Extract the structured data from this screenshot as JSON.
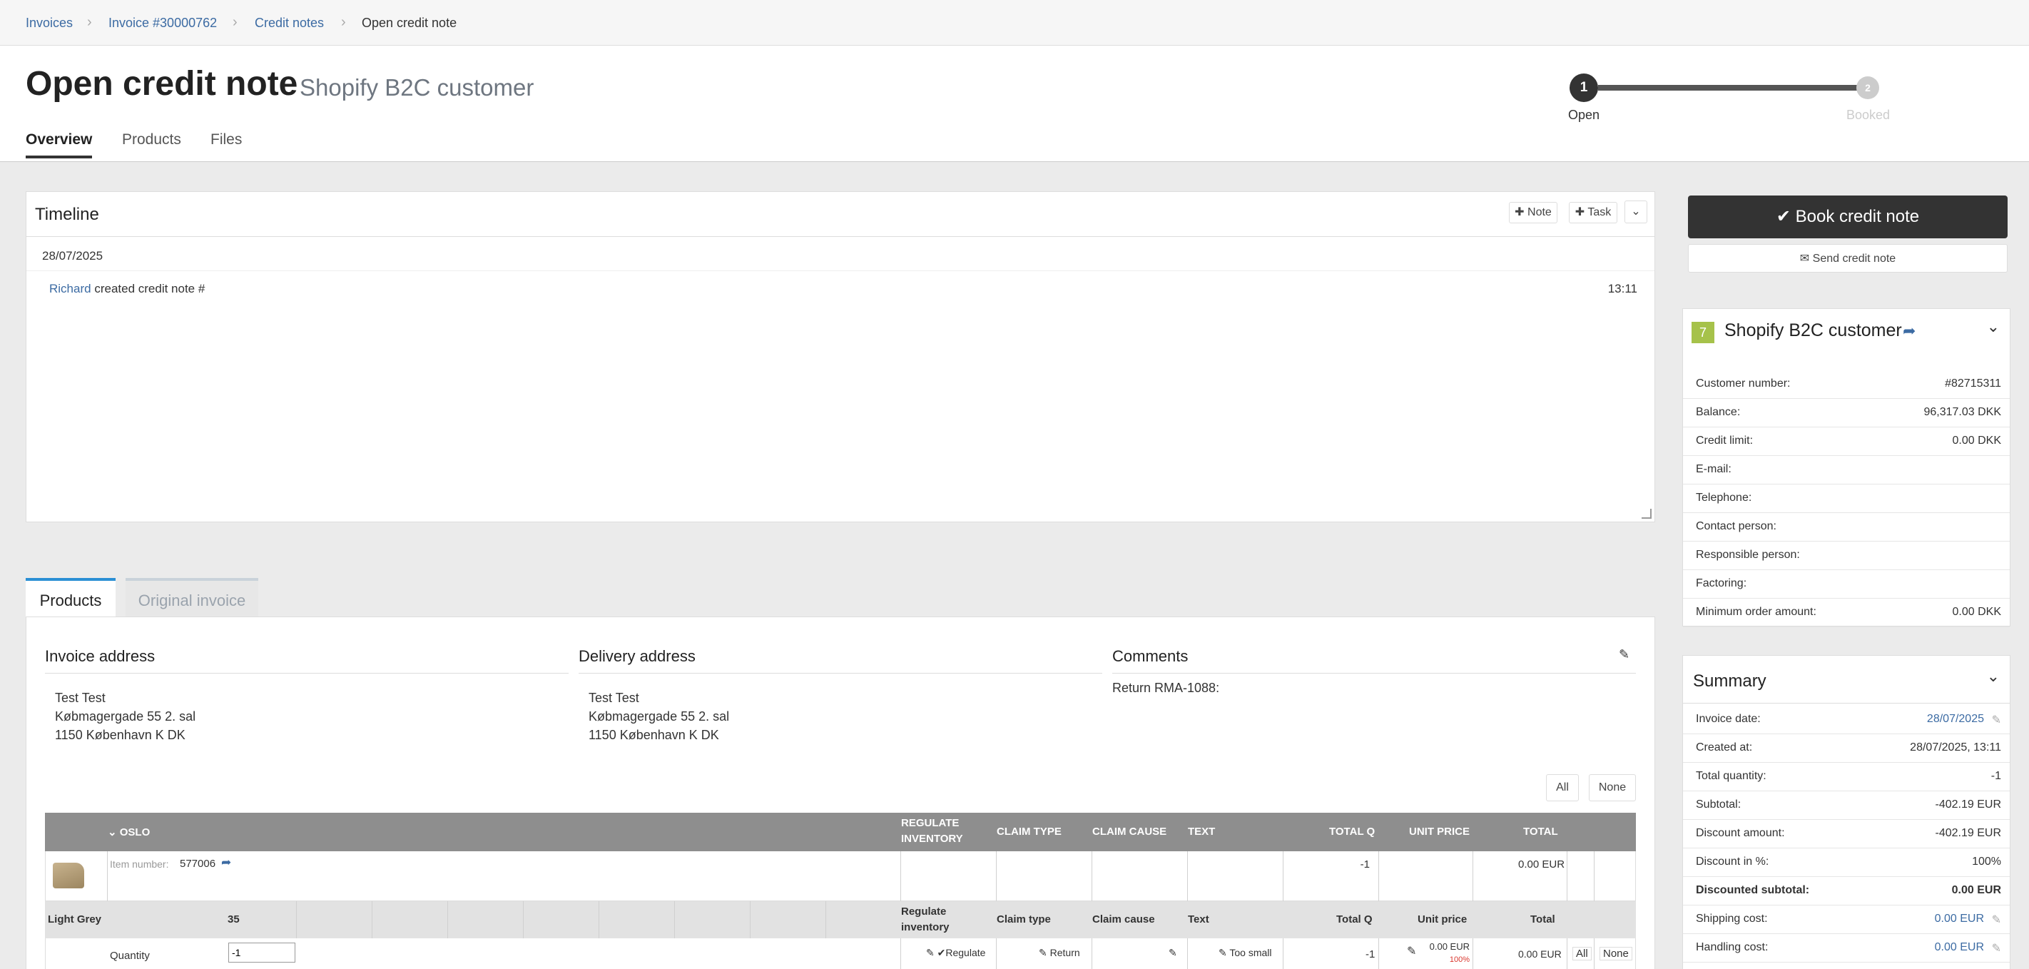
{
  "breadcrumb": {
    "items": [
      "Invoices",
      "Invoice #30000762",
      "Credit notes"
    ],
    "current": "Open credit note"
  },
  "header": {
    "title": "Open credit note",
    "subtitle": "Shopify B2C customer",
    "tabs": [
      "Overview",
      "Products",
      "Files"
    ]
  },
  "steps": [
    {
      "num": "1",
      "label": "Open"
    },
    {
      "num": "2",
      "label": "Booked"
    }
  ],
  "timeline": {
    "title": "Timeline",
    "note_btn": "Note",
    "task_btn": "Task",
    "date": "28/07/2025",
    "user": "Richard",
    "text": "created credit note #",
    "time": "13:11"
  },
  "actions": {
    "book": "Book credit note",
    "send": "Send credit note"
  },
  "customer": {
    "badge": "7",
    "name": "Shopify B2C customer",
    "rows": [
      {
        "label": "Customer number:",
        "value": "#82715311"
      },
      {
        "label": "Balance:",
        "value": "96,317.03 DKK"
      },
      {
        "label": "Credit limit:",
        "value": "0.00 DKK"
      },
      {
        "label": "E-mail:",
        "value": ""
      },
      {
        "label": "Telephone:",
        "value": ""
      },
      {
        "label": "Contact person:",
        "value": ""
      },
      {
        "label": "Responsible person:",
        "value": ""
      },
      {
        "label": "Factoring:",
        "value": ""
      },
      {
        "label": "Minimum order amount:",
        "value": "0.00 DKK"
      }
    ]
  },
  "summary": {
    "title": "Summary",
    "rows": [
      {
        "label": "Invoice date:",
        "value": "28/07/2025"
      },
      {
        "label": "Created at:",
        "value": "28/07/2025, 13:11"
      },
      {
        "label": "Total quantity:",
        "value": "-1"
      },
      {
        "label": "Subtotal:",
        "value": "-402.19 EUR"
      },
      {
        "label": "Discount amount:",
        "value": "-402.19 EUR"
      },
      {
        "label": "Discount in %:",
        "value": "100%"
      },
      {
        "label": "Discounted subtotal:",
        "value": "0.00 EUR"
      },
      {
        "label": "Shipping cost:",
        "value": "0.00 EUR"
      },
      {
        "label": "Handling cost:",
        "value": "0.00 EUR"
      }
    ]
  },
  "products_tabs": [
    "Products",
    "Original invoice"
  ],
  "invoice_address": {
    "title": "Invoice address",
    "lines": [
      "Test Test",
      "Købmagergade 55 2. sal",
      "1150 København K DK"
    ]
  },
  "delivery_address": {
    "title": "Delivery address",
    "lines": [
      "Test Test",
      "Købmagergade 55 2. sal",
      "1150 København K DK"
    ]
  },
  "comments": {
    "title": "Comments",
    "text": "Return RMA-1088:"
  },
  "select": {
    "all": "All",
    "none": "None"
  },
  "table": {
    "group": "OSLO",
    "headers": {
      "regulate": "REGULATE INVENTORY",
      "claim_type": "CLAIM TYPE",
      "claim_cause": "CLAIM CAUSE",
      "text": "TEXT",
      "total_q": "TOTAL Q",
      "unit_price": "UNIT PRICE",
      "total": "TOTAL"
    },
    "item": {
      "label": "Item number:",
      "number": "577006",
      "total_q": "-1",
      "total": "0.00 EUR"
    },
    "variant": {
      "color": "Light Grey",
      "size": "35",
      "regulate": "Regulate inventory",
      "claim_type": "Claim type",
      "claim_cause": "Claim cause",
      "text": "Text",
      "total_q": "Total Q",
      "unit_price": "Unit price",
      "total": "Total"
    },
    "qty": {
      "label": "Quantity",
      "value": "-1",
      "regulate": "Regulate",
      "claim_type": "Return",
      "text": "Too small",
      "total_q": "-1",
      "unit_price": "0.00 EUR",
      "discount": "100%",
      "total": "0.00 EUR",
      "all": "All",
      "none": "None"
    }
  }
}
